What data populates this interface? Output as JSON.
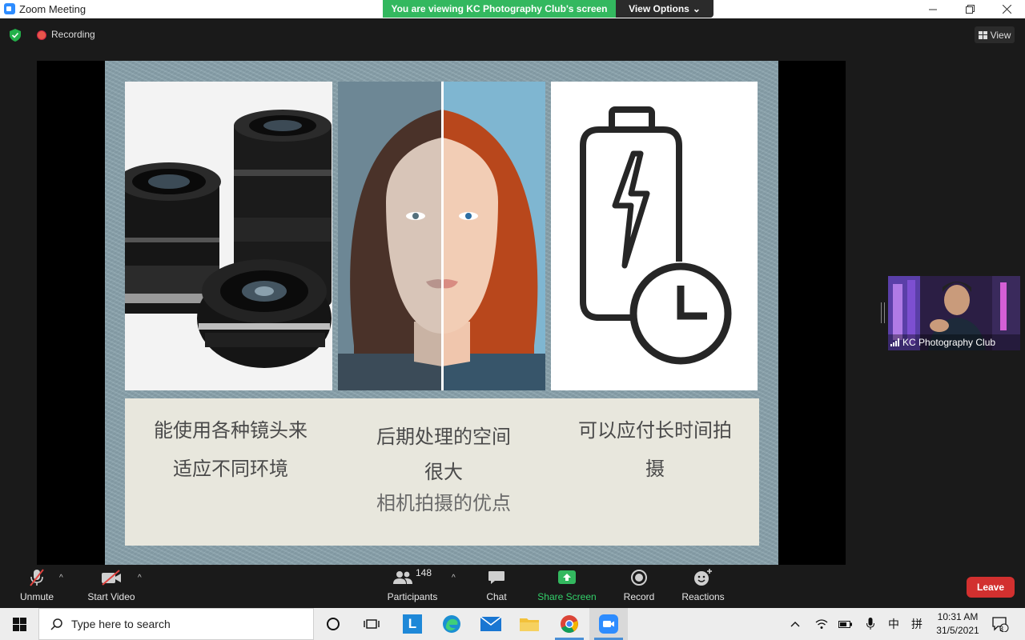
{
  "window": {
    "title": "Zoom Meeting"
  },
  "banner": {
    "viewing": "You are viewing KC Photography Club's screen",
    "view_options": "View Options",
    "view_options_caret": "⌄"
  },
  "status": {
    "recording": "Recording",
    "view": "View"
  },
  "slide": {
    "captions": [
      {
        "line1": "能使用各种镜头来",
        "line2": "适应不同环境"
      },
      {
        "line1": "后期处理的空间",
        "line2": "很大",
        "line3": "相机拍摄的优点"
      },
      {
        "line1": "可以应付长时间拍",
        "line2": "摄"
      }
    ]
  },
  "participant": {
    "name": "KC Photography Club"
  },
  "toolbar": {
    "unmute": "Unmute",
    "start_video": "Start Video",
    "participants": "Participants",
    "participant_count": "148",
    "chat": "Chat",
    "share_screen": "Share Screen",
    "record": "Record",
    "reactions": "Reactions",
    "leave": "Leave",
    "caret": "^"
  },
  "taskbar": {
    "search_placeholder": "Type here to search",
    "time": "10:31 AM",
    "date": "31/5/2021",
    "ime_lang": "中",
    "ime_mode": "拼",
    "notification_count": "3",
    "app_letter": "L"
  },
  "colors": {
    "share_green": "#33b85f",
    "leave_red": "#d2302f",
    "zoom_blue": "#2D8CFF"
  },
  "icons": [
    "zoom-icon",
    "shield-icon",
    "record-dot-icon",
    "view-grid-icon",
    "mic-muted-icon",
    "video-muted-icon",
    "participants-icon",
    "chat-icon",
    "share-screen-icon",
    "record-icon",
    "reactions-icon",
    "windows-start-icon",
    "search-icon",
    "cortana-icon",
    "task-view-icon",
    "edge-icon",
    "mail-icon",
    "file-explorer-icon",
    "chrome-icon",
    "zoom-taskbar-icon",
    "chevron-up-icon",
    "wifi-icon",
    "battery-icon",
    "microphone-icon",
    "notification-icon"
  ]
}
